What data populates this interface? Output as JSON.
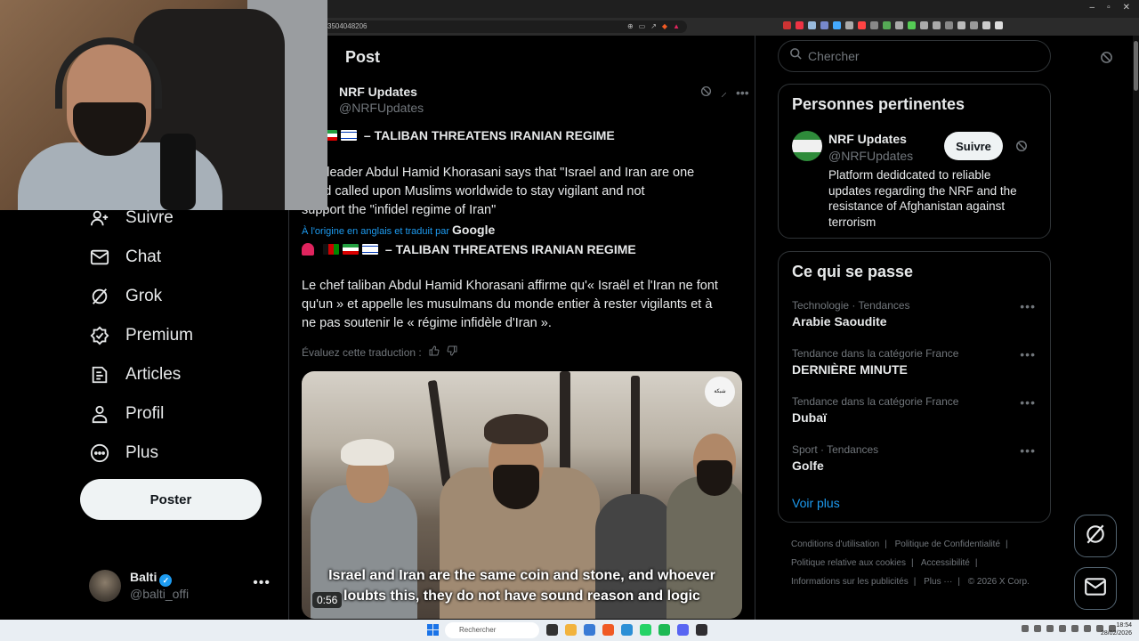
{
  "browser": {
    "url": "3504048206",
    "window_controls": [
      "–",
      "▫",
      "✕"
    ]
  },
  "sidebar": {
    "items": [
      {
        "label": "Suivre",
        "icon": "add-user-icon"
      },
      {
        "label": "Chat",
        "icon": "mail-icon"
      },
      {
        "label": "Grok",
        "icon": "grok-icon"
      },
      {
        "label": "Premium",
        "icon": "verified-badge-icon"
      },
      {
        "label": "Articles",
        "icon": "article-icon"
      },
      {
        "label": "Profil",
        "icon": "profile-icon"
      },
      {
        "label": "Plus",
        "icon": "more-circle-icon"
      }
    ],
    "post_button": "Poster",
    "account": {
      "name": "Balti",
      "handle": "@balti_offi",
      "more": "•••"
    }
  },
  "post": {
    "header": "Post",
    "author_name": "NRF Updates",
    "author_handle": "@NRFUpdates",
    "headline": "– TALIBAN THREATENS IRANIAN REGIME",
    "original_lines": [
      "ban leader Abdul Hamid Khorasani says that \"Israel and Iran are one",
      "\" and called upon Muslims worldwide to stay vigilant and not",
      "support the \"infidel regime of Iran\""
    ],
    "translated_prefix": "À l'origine en anglais et traduit par",
    "translated_by": "Google",
    "translated_headline": "– TALIBAN THREATENS IRANIAN REGIME",
    "translated_lines": [
      "Le chef taliban Abdul Hamid Khorasani affirme qu'« Israël et l'Iran ne font",
      "qu'un » et appelle les musulmans du monde entier à rester vigilants et à",
      "ne pas soutenir le « régime infidèle d'Iran »."
    ],
    "rate_label": "Évaluez cette traduction :",
    "video": {
      "caption_line1": "Israel and Iran are the same coin and stone, and whoever",
      "caption_line2": "loubts this, they do not have sound reason and logic",
      "timer": "0:56",
      "watermark": "شبكة"
    }
  },
  "right": {
    "search_placeholder": "Chercher",
    "relevant": {
      "title": "Personnes pertinentes",
      "name": "NRF Updates",
      "handle": "@NRFUpdates",
      "follow": "Suivre",
      "bio": "Platform dedidcated to reliable updates regarding the NRF and the resistance of Afghanistan against terrorism"
    },
    "trends": {
      "title": "Ce qui se passe",
      "items": [
        {
          "category": "Technologie · Tendances",
          "name": "Arabie Saoudite"
        },
        {
          "category": "Tendance dans la catégorie France",
          "name": "DERNIÈRE MINUTE"
        },
        {
          "category": "Tendance dans la catégorie France",
          "name": "Dubaï"
        },
        {
          "category": "Sport · Tendances",
          "name": "Golfe"
        }
      ],
      "see_more": "Voir plus"
    },
    "footer": {
      "links": [
        "Conditions d'utilisation",
        "Politique de Confidentialité",
        "Politique relative aux cookies",
        "Accessibilité",
        "Informations sur les publicités",
        "Plus ···"
      ],
      "copyright": "© 2026 X Corp."
    }
  },
  "taskbar": {
    "search": "Rechercher",
    "time": "18:54",
    "date": "28/02/2026"
  },
  "colors": {
    "accent": "#1d9bf0",
    "background": "#000000",
    "border": "#2f3336",
    "muted": "#71767b"
  }
}
